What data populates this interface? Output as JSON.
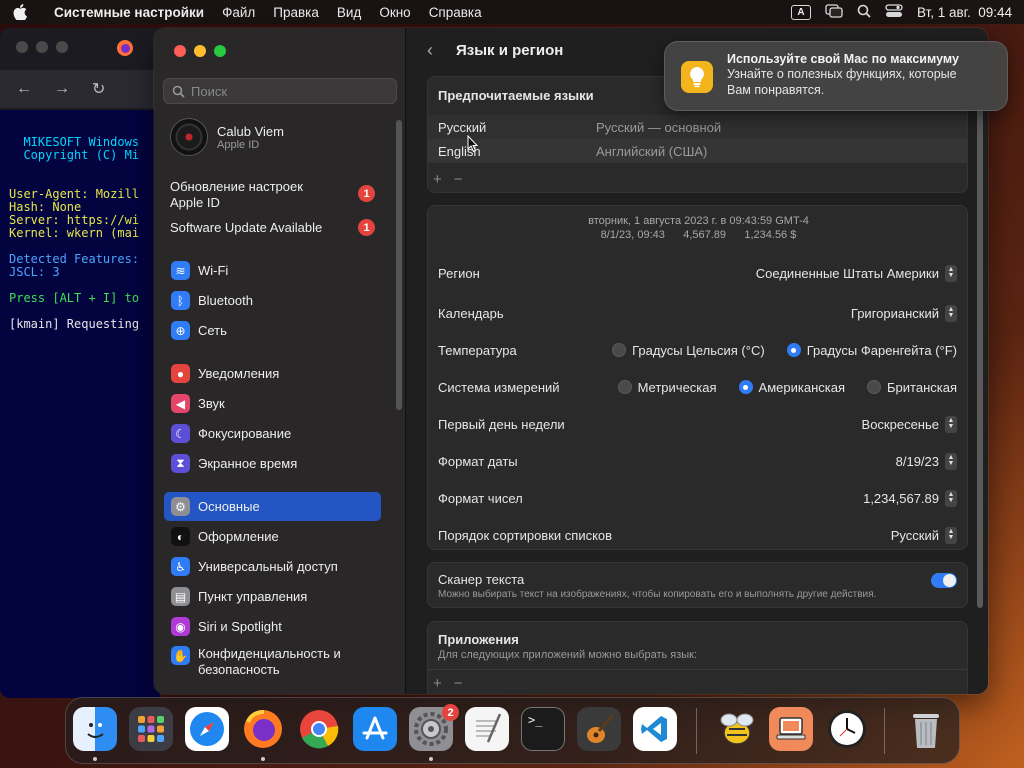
{
  "menubar": {
    "app": "Системные настройки",
    "items": [
      "Файл",
      "Правка",
      "Вид",
      "Окно",
      "Справка"
    ],
    "input_lang": "A",
    "datetime": "Вт, 1 авг.  09:44"
  },
  "terminal": {
    "lines": [
      {
        "text": "",
        "color": "#00d7ff"
      },
      {
        "text": "",
        "color": "#00d7ff"
      },
      {
        "text": "  MIKESOFT Windows",
        "color": "#00d7ff"
      },
      {
        "text": "  Copyright (C) Mi",
        "color": "#00d7ff"
      },
      {
        "text": "",
        "color": "#fff"
      },
      {
        "text": "",
        "color": "#fff"
      },
      {
        "text": "User-Agent: Mozill",
        "color": "#e6e64a"
      },
      {
        "text": "Hash: None",
        "color": "#e6e64a"
      },
      {
        "text": "Server: https://wi",
        "color": "#e6e64a"
      },
      {
        "text": "Kernel: wkern (mai",
        "color": "#e6e64a"
      },
      {
        "text": "",
        "color": "#fff"
      },
      {
        "text": "Detected Features:",
        "color": "#4aa6ff"
      },
      {
        "text": "JSCL: 3",
        "color": "#4aa6ff"
      },
      {
        "text": "",
        "color": "#fff"
      },
      {
        "text": "Press [ALT + I] to",
        "color": "#3fe04f"
      },
      {
        "text": "",
        "color": "#fff"
      },
      {
        "text": "[kmain] Requesting",
        "color": "#e6e6e6"
      }
    ]
  },
  "sidebar": {
    "search_placeholder": "Поиск",
    "user": {
      "name": "Calub Viem",
      "sub": "Apple ID"
    },
    "update1": {
      "line1": "Обновление настроек",
      "line2": "Apple ID",
      "badge": "1"
    },
    "update2": {
      "label": "Software Update Available",
      "badge": "1"
    },
    "items": [
      {
        "label": "Wi-Fi",
        "icon": "wifi-icon",
        "color": "#2f7cf6",
        "glyph": "≋"
      },
      {
        "label": "Bluetooth",
        "icon": "bluetooth-icon",
        "color": "#2f7cf6",
        "glyph": "ᛒ"
      },
      {
        "label": "Сеть",
        "icon": "globe-icon",
        "color": "#2f7cf6",
        "glyph": "⊕"
      },
      {
        "label": "Уведомления",
        "icon": "bell-icon",
        "color": "#e3453e",
        "glyph": "●"
      },
      {
        "label": "Звук",
        "icon": "speaker-icon",
        "color": "#e3456b",
        "glyph": "◀"
      },
      {
        "label": "Фокусирование",
        "icon": "moon-icon",
        "color": "#5b4fd6",
        "glyph": "☾"
      },
      {
        "label": "Экранное время",
        "icon": "hourglass-icon",
        "color": "#5b4fd6",
        "glyph": "⧗"
      },
      {
        "label": "Основные",
        "icon": "gear-icon",
        "color": "#8e8e93",
        "glyph": "⚙",
        "selected": true
      },
      {
        "label": "Оформление",
        "icon": "appearance-icon",
        "color": "#111111",
        "glyph": "◐"
      },
      {
        "label": "Универсальный доступ",
        "icon": "accessibility-icon",
        "color": "#2f7cf6",
        "glyph": "♿"
      },
      {
        "label": "Пункт управления",
        "icon": "control-center-icon",
        "color": "#8e8e93",
        "glyph": "▤"
      },
      {
        "label": "Siri и Spotlight",
        "icon": "siri-icon",
        "color": "#b03ad6",
        "glyph": "◉"
      },
      {
        "label": "Конфиденциальность и безопасность",
        "icon": "hand-icon",
        "color": "#2f7cf6",
        "glyph": "✋"
      }
    ]
  },
  "main": {
    "title": "Язык и регион",
    "languages": {
      "header": "Предпочитаемые языки",
      "rows": [
        {
          "name": "Русский",
          "desc": "Русский — основной"
        },
        {
          "name": "English",
          "desc": "Английский (США)"
        }
      ]
    },
    "preview": {
      "line1": "вторник, 1 августа 2023 г. в 09:43:59 GMT-4",
      "line2": "8/1/23, 09:43      4,567.89      1,234.56 $"
    },
    "region": {
      "label": "Регион",
      "value": "Соединенные Штаты Америки"
    },
    "calendar": {
      "label": "Календарь",
      "value": "Григорианский"
    },
    "temperature": {
      "label": "Температура",
      "opt1": "Градусы Цельсия (°C)",
      "opt2": "Градусы Фаренгейта (°F)",
      "selected": 2
    },
    "measure": {
      "label": "Система измерений",
      "opt1": "Метрическая",
      "opt2": "Американская",
      "opt3": "Британская",
      "selected": 2
    },
    "firstday": {
      "label": "Первый день недели",
      "value": "Воскресенье"
    },
    "dateformat": {
      "label": "Формат даты",
      "value": "8/19/23"
    },
    "numformat": {
      "label": "Формат чисел",
      "value": "1,234,567.89"
    },
    "sortorder": {
      "label": "Порядок сортировки списков",
      "value": "Русский"
    },
    "scanner": {
      "title": "Сканер текста",
      "desc": "Можно выбирать текст на изображениях, чтобы копировать его и выполнять другие действия.",
      "enabled": true
    },
    "apps": {
      "title": "Приложения",
      "desc": "Для следующих приложений можно выбрать язык:"
    }
  },
  "notification": {
    "title": "Используйте свой Mac по максимуму",
    "body1": "Узнайте о полезных функциях, которые",
    "body2": "Вам понравятся."
  },
  "dock": {
    "settings_badge": "2"
  }
}
